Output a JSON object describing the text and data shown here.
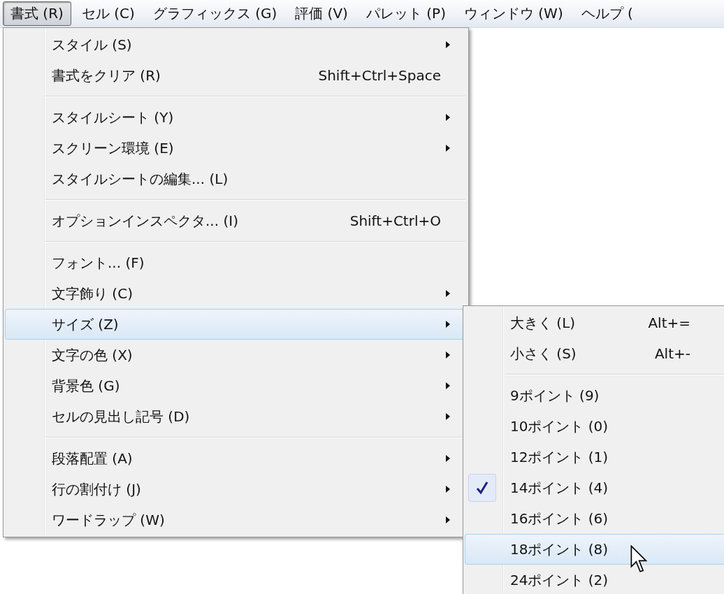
{
  "menubar": [
    {
      "label": "書式 (R)",
      "selected": true
    },
    {
      "label": "セル (C)",
      "selected": false
    },
    {
      "label": "グラフィックス (G)",
      "selected": false
    },
    {
      "label": "評価 (V)",
      "selected": false
    },
    {
      "label": "パレット (P)",
      "selected": false
    },
    {
      "label": "ウィンドウ (W)",
      "selected": false
    },
    {
      "label": "ヘルプ (",
      "selected": false
    }
  ],
  "menu": {
    "groups": [
      [
        {
          "label": "スタイル (S)",
          "submenu": true,
          "selected": false
        },
        {
          "label": "書式をクリア (R)",
          "shortcut": "Shift+Ctrl+Space",
          "submenu": false,
          "selected": false
        }
      ],
      [
        {
          "label": "スタイルシート (Y)",
          "submenu": true,
          "selected": false
        },
        {
          "label": "スクリーン環境 (E)",
          "submenu": true,
          "selected": false
        },
        {
          "label": "スタイルシートの編集... (L)",
          "submenu": false,
          "selected": false
        }
      ],
      [
        {
          "label": "オプションインスペクタ... (I)",
          "shortcut": "Shift+Ctrl+O",
          "submenu": false,
          "selected": false
        }
      ],
      [
        {
          "label": "フォント... (F)",
          "submenu": false,
          "selected": false
        },
        {
          "label": "文字飾り (C)",
          "submenu": true,
          "selected": false
        },
        {
          "label": "サイズ (Z)",
          "submenu": true,
          "selected": true
        },
        {
          "label": "文字の色 (X)",
          "submenu": true,
          "selected": false
        },
        {
          "label": "背景色 (G)",
          "submenu": true,
          "selected": false
        },
        {
          "label": "セルの見出し記号 (D)",
          "submenu": true,
          "selected": false
        }
      ],
      [
        {
          "label": "段落配置 (A)",
          "submenu": true,
          "selected": false
        },
        {
          "label": "行の割付け (J)",
          "submenu": true,
          "selected": false
        },
        {
          "label": "ワードラップ (W)",
          "submenu": true,
          "selected": false
        }
      ]
    ]
  },
  "submenu": {
    "groups": [
      [
        {
          "label": "大きく (L)",
          "shortcut": "Alt+=",
          "checked": false,
          "selected": false
        },
        {
          "label": "小さく (S)",
          "shortcut": "Alt+-",
          "checked": false,
          "selected": false
        }
      ],
      [
        {
          "label": "9ポイント (9)",
          "checked": false,
          "selected": false
        },
        {
          "label": "10ポイント (0)",
          "checked": false,
          "selected": false
        },
        {
          "label": "12ポイント (1)",
          "checked": false,
          "selected": false
        },
        {
          "label": "14ポイント (4)",
          "checked": true,
          "selected": false
        },
        {
          "label": "16ポイント (6)",
          "checked": false,
          "selected": false
        },
        {
          "label": "18ポイント (8)",
          "checked": false,
          "selected": true
        },
        {
          "label": "24ポイント (2)",
          "checked": false,
          "selected": false
        }
      ]
    ]
  }
}
